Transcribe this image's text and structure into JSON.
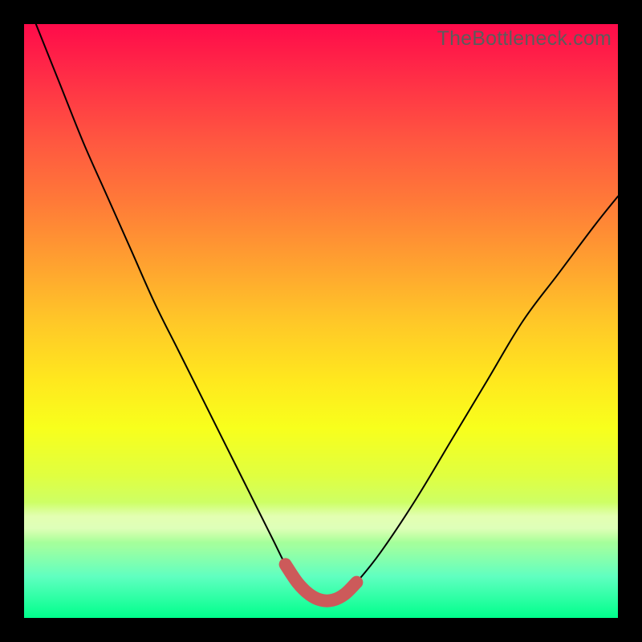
{
  "watermark": "TheBottleneck.com",
  "colors": {
    "gradient_top": "#ff0b4a",
    "gradient_bottom": "#00ff8c",
    "curve_stroke": "#000000",
    "valley_stroke": "#cc5a5a",
    "frame": "#000000"
  },
  "chart_data": {
    "type": "line",
    "title": "",
    "xlabel": "",
    "ylabel": "",
    "xlim": [
      0,
      100
    ],
    "ylim": [
      0,
      100
    ],
    "series": [
      {
        "name": "bottleneck-curve",
        "x": [
          2,
          6,
          10,
          14,
          18,
          22,
          26,
          30,
          34,
          38,
          42,
          44,
          46,
          48,
          50,
          52,
          54,
          56,
          60,
          66,
          72,
          78,
          84,
          90,
          96,
          100
        ],
        "y": [
          100,
          90,
          80,
          71,
          62,
          53,
          45,
          37,
          29,
          21,
          13,
          9,
          6,
          4,
          3,
          3,
          4,
          6,
          11,
          20,
          30,
          40,
          50,
          58,
          66,
          71
        ]
      },
      {
        "name": "valley-highlight",
        "x": [
          44,
          46,
          48,
          50,
          52,
          54,
          56
        ],
        "y": [
          9,
          6,
          4,
          3,
          3,
          4,
          6
        ]
      }
    ],
    "annotations": []
  }
}
